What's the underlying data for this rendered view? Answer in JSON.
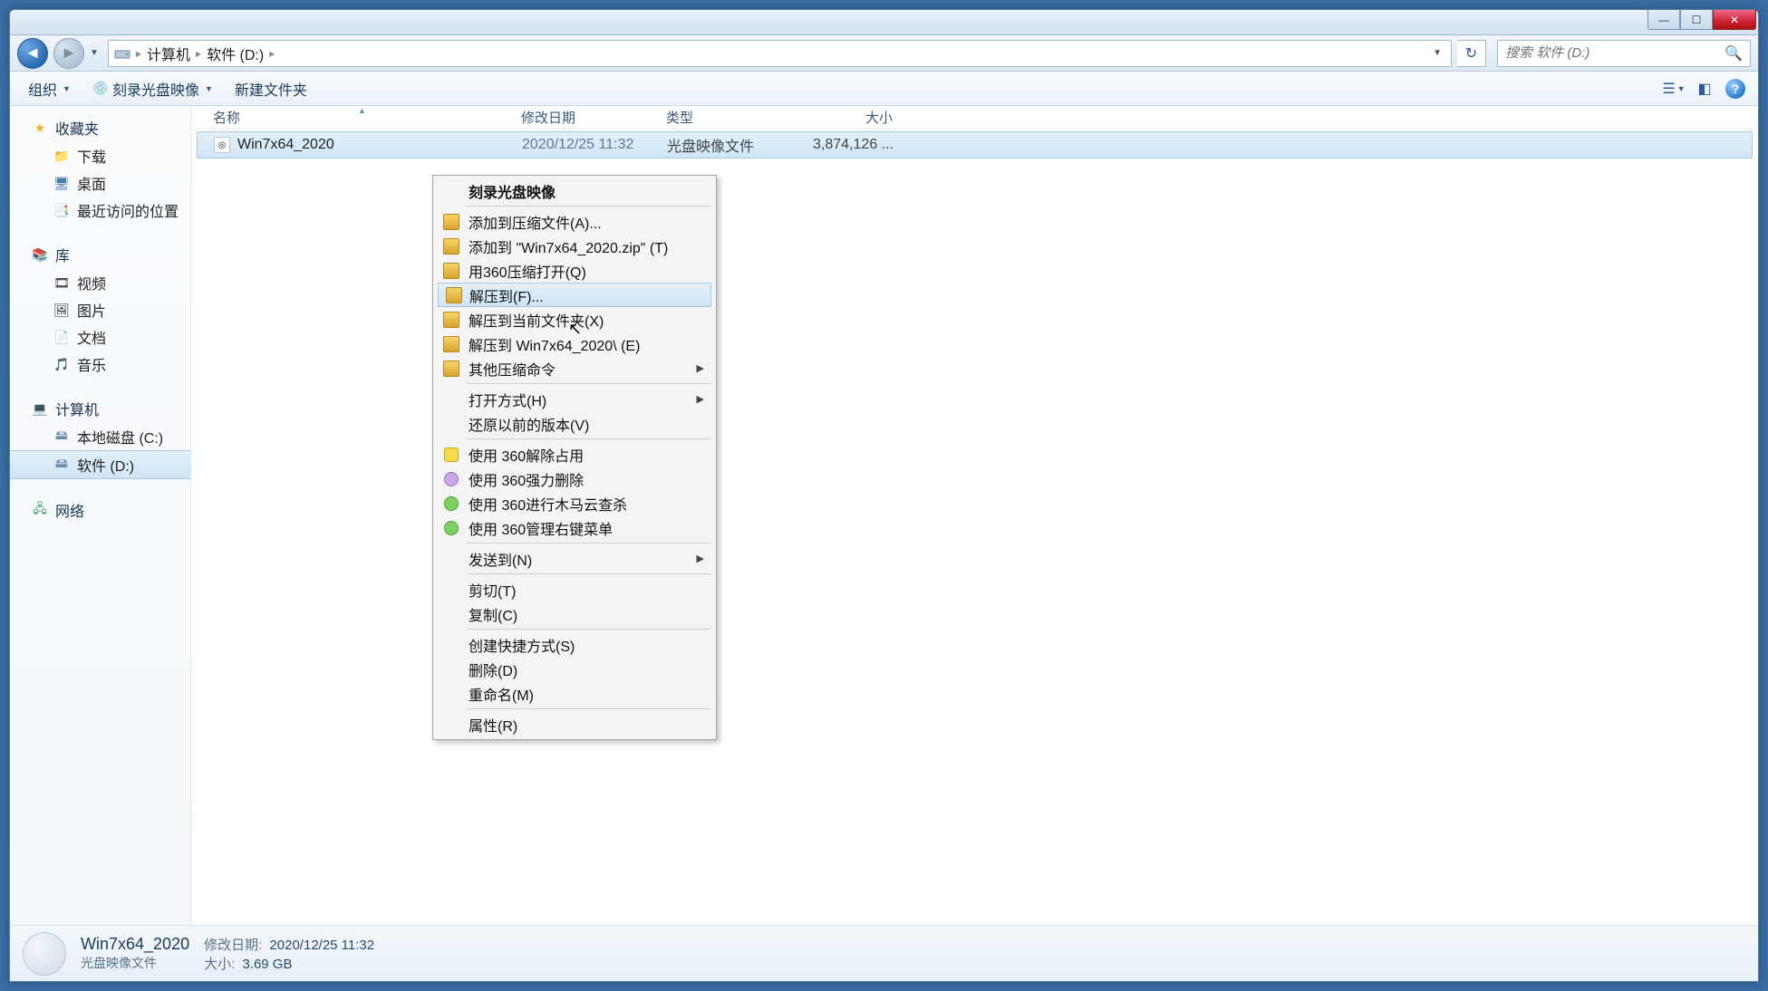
{
  "breadcrumb": {
    "root": "计算机",
    "current": "软件 (D:)"
  },
  "search": {
    "placeholder": "搜索 软件 (D:)"
  },
  "toolbar": {
    "organize": "组织",
    "burn": "刻录光盘映像",
    "newfolder": "新建文件夹"
  },
  "columns": {
    "name": "名称",
    "date": "修改日期",
    "type": "类型",
    "size": "大小"
  },
  "sidebar": {
    "favorites": {
      "head": "收藏夹",
      "items": [
        "下载",
        "桌面",
        "最近访问的位置"
      ]
    },
    "libraries": {
      "head": "库",
      "items": [
        "视频",
        "图片",
        "文档",
        "音乐"
      ]
    },
    "computer": {
      "head": "计算机",
      "items": [
        "本地磁盘 (C:)",
        "软件 (D:)"
      ]
    },
    "network": {
      "head": "网络"
    }
  },
  "file": {
    "name": "Win7x64_2020",
    "date": "2020/12/25 11:32",
    "type": "光盘映像文件",
    "size": "3,874,126 ..."
  },
  "details": {
    "title": "Win7x64_2020",
    "type": "光盘映像文件",
    "date_label": "修改日期:",
    "date": "2020/12/25 11:32",
    "size_label": "大小:",
    "size": "3.69 GB"
  },
  "context": {
    "burn": "刻录光盘映像",
    "addToArchive": "添加到压缩文件(A)...",
    "addToZip": "添加到 \"Win7x64_2020.zip\" (T)",
    "openWith360": "用360压缩打开(Q)",
    "extractTo": "解压到(F)...",
    "extractHere": "解压到当前文件夹(X)",
    "extractToFolder": "解压到 Win7x64_2020\\ (E)",
    "otherCompress": "其他压缩命令",
    "openWith": "打开方式(H)",
    "restorePrev": "还原以前的版本(V)",
    "use360Unlock": "使用 360解除占用",
    "use360Force": "使用 360强力删除",
    "use360Scan": "使用 360进行木马云查杀",
    "use360Menu": "使用 360管理右键菜单",
    "sendTo": "发送到(N)",
    "cut": "剪切(T)",
    "copy": "复制(C)",
    "shortcut": "创建快捷方式(S)",
    "delete": "删除(D)",
    "rename": "重命名(M)",
    "properties": "属性(R)"
  }
}
